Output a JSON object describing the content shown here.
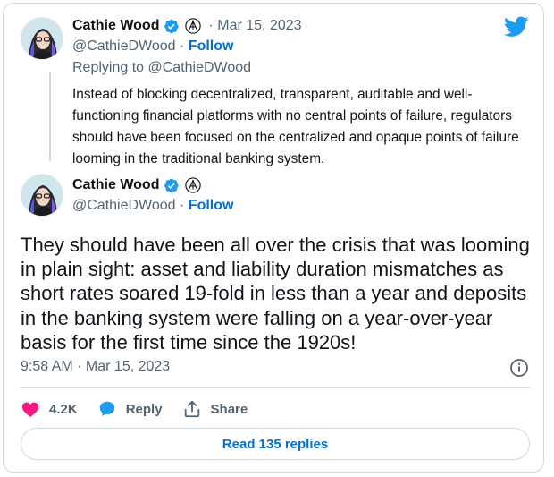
{
  "quoted_tweet": {
    "author_name": "Cathie Wood",
    "handle": "@CathieDWood",
    "separator": "·",
    "follow_label": "Follow",
    "date": "· Mar 15, 2023",
    "replying_to": "Replying to @CathieDWood",
    "text": "Instead of blocking decentralized, transparent, auditable and well-functioning financial platforms with no central points of failure, regulators should have been focused on the centralized and opaque points of failure looming in the traditional banking system."
  },
  "main_tweet": {
    "author_name": "Cathie Wood",
    "handle": "@CathieDWood",
    "separator": "·",
    "follow_label": "Follow",
    "text": "They should have been all over the crisis that was looming in plain sight: asset and liability duration mismatches as short rates soared 19-fold in less than a year and deposits in the banking system were falling on a year-over-year basis for the first time since the 1920s!",
    "timestamp": "9:58 AM · Mar 15, 2023"
  },
  "actions": {
    "like_count": "4.2K",
    "reply_label": "Reply",
    "share_label": "Share"
  },
  "read_replies_label": "Read 135 replies",
  "icons": {
    "brand": "twitter-bird-icon",
    "verified": "verified-badge-icon",
    "affiliate": "ark-badge-icon",
    "like": "heart-icon",
    "reply": "speech-bubble-icon",
    "share": "share-upload-icon",
    "info": "info-icon"
  },
  "colors": {
    "twitter_blue": "#1d9bf0",
    "link_blue": "#006fd6",
    "heart_pink": "#f91880",
    "muted_text": "#536471",
    "border": "#cfd9de"
  }
}
